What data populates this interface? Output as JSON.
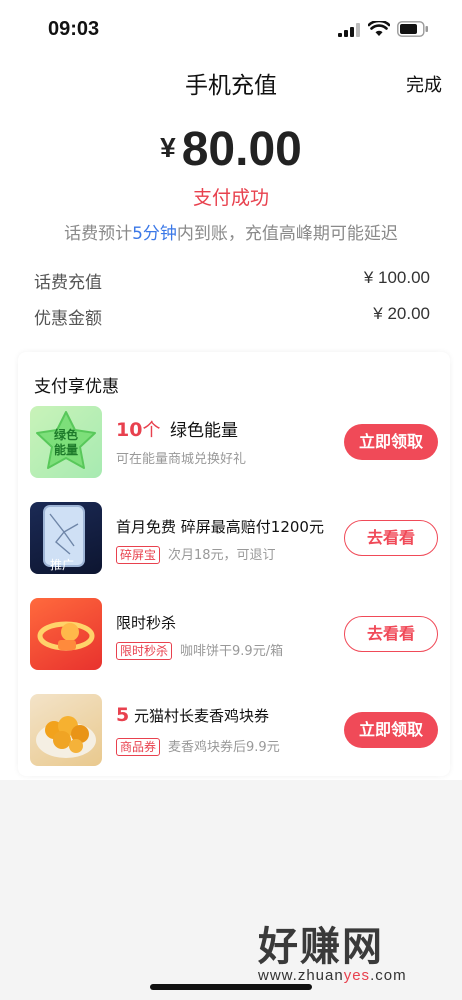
{
  "status_bar": {
    "time": "09:03"
  },
  "nav": {
    "title": "手机充值",
    "done_label": "完成"
  },
  "payment": {
    "currency": "¥",
    "amount": "80.00",
    "status": "支付成功",
    "arrival_prefix": "话费预计",
    "arrival_time": "5分钟",
    "arrival_suffix": "内到账，充值高峰期可能延迟"
  },
  "details": [
    {
      "label": "话费充值",
      "value": "¥ 100.00"
    },
    {
      "label": "优惠金额",
      "value": "¥ 20.00"
    }
  ],
  "promo": {
    "title": "支付享优惠",
    "items": [
      {
        "count": "10",
        "unit": "个",
        "name": "绿色能量",
        "subtitle": "可在能量商城兑换好礼",
        "thumb_text_1": "绿色",
        "thumb_text_2": "能量",
        "button": "立即领取"
      },
      {
        "title": "首月免费  碎屏最高赔付1200元",
        "tag": "碎屏宝",
        "subtitle": "次月18元，可退订",
        "thumb_badge": "推广",
        "button": "去看看"
      },
      {
        "title": "限时秒杀",
        "tag": "限时秒杀",
        "subtitle": "咖啡饼干9.9元/箱",
        "button": "去看看"
      },
      {
        "count": "5",
        "title": "元猫村长麦香鸡块券",
        "tag": "商品券",
        "subtitle": "麦香鸡块券后9.9元",
        "button": "立即领取"
      }
    ]
  },
  "watermark": {
    "main": "好赚网",
    "sub_1": "www.zhuan",
    "sub_2": "yes",
    "sub_3": ".com"
  },
  "colors": {
    "accent_red": "#f04a58",
    "highlight_blue": "#3b78e7"
  }
}
